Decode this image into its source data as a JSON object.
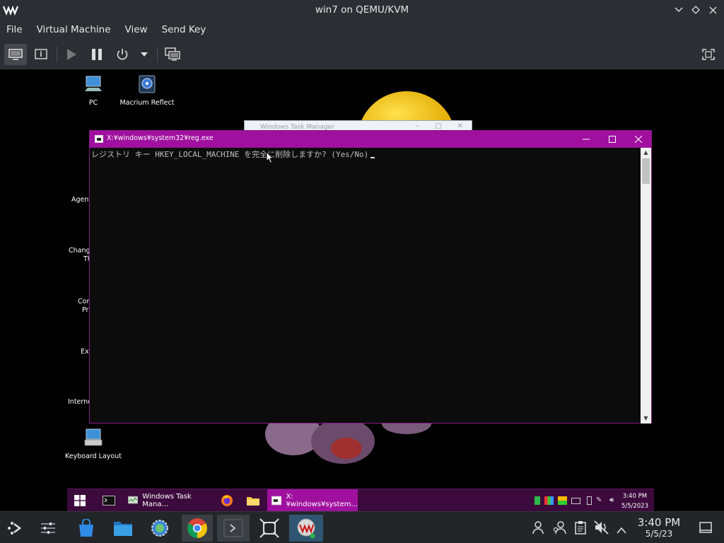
{
  "host": {
    "title": "win7 on QEMU/KVM",
    "menu": [
      "File",
      "Virtual Machine",
      "View",
      "Send Key"
    ]
  },
  "desktop_icons": [
    {
      "label": "PC",
      "icon": "computer-icon"
    },
    {
      "label": "Macrium Reflect",
      "icon": "backup-disk-icon"
    },
    {
      "label": "Keyboard Layout",
      "icon": "keyboard-icon"
    }
  ],
  "desktop_partial_labels": [
    "Agent",
    "Chang",
    "Th",
    "Con",
    "Pr",
    "Exp",
    "Interne"
  ],
  "task_manager": {
    "title": "Windows Task Manager"
  },
  "console": {
    "title": "X:¥windows¥system32¥reg.exe",
    "prompt": "レジストリ キー HKEY_LOCAL_MACHINE を完全に削除しますか? (Yes/No)"
  },
  "guest_taskbar": {
    "items": [
      {
        "label": "",
        "icon": "cmd-icon"
      },
      {
        "label": "Windows Task Mana...",
        "icon": "task-manager-icon"
      },
      {
        "label": "",
        "icon": "firefox-icon"
      },
      {
        "label": "",
        "icon": "folder-icon"
      },
      {
        "label": "X:¥windows¥system...",
        "icon": "console-icon"
      }
    ],
    "time": "3:40 PM",
    "date": "5/5/2023"
  },
  "host_taskbar": {
    "time": "3:40 PM",
    "date": "5/5/23"
  }
}
